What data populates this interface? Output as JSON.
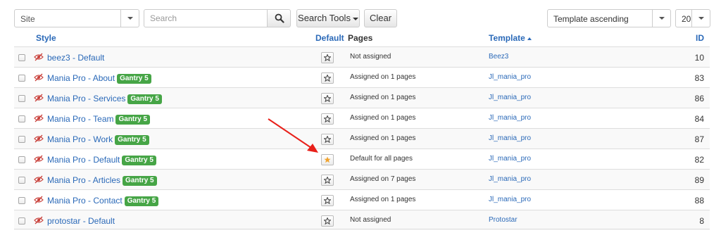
{
  "toolbar": {
    "client_select": "Site",
    "search_placeholder": "Search",
    "search_tools_label": "Search Tools",
    "clear_label": "Clear",
    "sort_select": "Template ascending",
    "limit_select": "20"
  },
  "columns": {
    "style": "Style",
    "default": "Default",
    "pages": "Pages",
    "template": "Template",
    "id": "ID"
  },
  "rows": [
    {
      "style": "beez3 - Default",
      "badge": "",
      "default": false,
      "pages": "Not assigned",
      "template": "Beez3",
      "id": "10"
    },
    {
      "style": "Mania Pro - About",
      "badge": "Gantry 5",
      "default": false,
      "pages": "Assigned on 1 pages",
      "template": "Jl_mania_pro",
      "id": "83"
    },
    {
      "style": "Mania Pro - Services",
      "badge": "Gantry 5",
      "default": false,
      "pages": "Assigned on 1 pages",
      "template": "Jl_mania_pro",
      "id": "86"
    },
    {
      "style": "Mania Pro - Team",
      "badge": "Gantry 5",
      "default": false,
      "pages": "Assigned on 1 pages",
      "template": "Jl_mania_pro",
      "id": "84"
    },
    {
      "style": "Mania Pro - Work",
      "badge": "Gantry 5",
      "default": false,
      "pages": "Assigned on 1 pages",
      "template": "Jl_mania_pro",
      "id": "87"
    },
    {
      "style": "Mania Pro - Default",
      "badge": "Gantry 5",
      "default": true,
      "pages": "Default for all pages",
      "template": "Jl_mania_pro",
      "id": "82"
    },
    {
      "style": "Mania Pro - Articles",
      "badge": "Gantry 5",
      "default": false,
      "pages": "Assigned on 7 pages",
      "template": "Jl_mania_pro",
      "id": "89"
    },
    {
      "style": "Mania Pro - Contact",
      "badge": "Gantry 5",
      "default": false,
      "pages": "Assigned on 1 pages",
      "template": "Jl_mania_pro",
      "id": "88"
    },
    {
      "style": "protostar - Default",
      "badge": "",
      "default": false,
      "pages": "Not assigned",
      "template": "Protostar",
      "id": "8"
    }
  ],
  "colors": {
    "link": "#2a69b8",
    "badge": "#46a546",
    "default_star": "#f0a32e",
    "arrow": "#e8201a",
    "hide_icon": "#c9413b"
  },
  "icons": {
    "search": "search-icon",
    "hidden": "eye-slash-icon",
    "star": "star-icon"
  }
}
